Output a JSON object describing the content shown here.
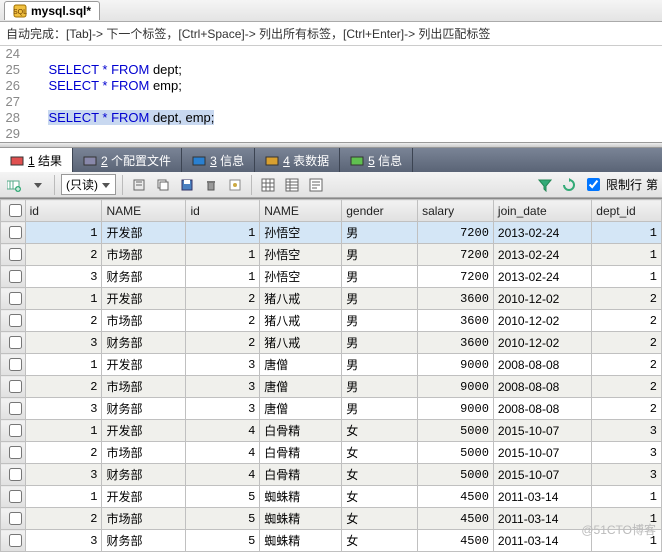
{
  "filetab": {
    "label": "mysql.sql*"
  },
  "tip": "自动完成：[Tab]-> 下一个标签，[Ctrl+Space]-> 列出所有标签，[Ctrl+Enter]-> 列出匹配标签",
  "editor": {
    "lines": [
      {
        "n": "24",
        "pre": "",
        "kw": "",
        "post": ""
      },
      {
        "n": "25",
        "pre": "    ",
        "kw": "SELECT * FROM",
        "post": " dept;"
      },
      {
        "n": "26",
        "pre": "    ",
        "kw": "SELECT * FROM",
        "post": " emp;"
      },
      {
        "n": "27",
        "pre": "",
        "kw": "",
        "post": ""
      },
      {
        "n": "28",
        "pre": "    ",
        "kw": "SELECT * FROM",
        "post": " dept, emp;",
        "sel": true
      },
      {
        "n": "29",
        "pre": "",
        "kw": "",
        "post": ""
      }
    ]
  },
  "result_tabs": [
    {
      "key": "1",
      "label": "结果",
      "active": true
    },
    {
      "key": "2",
      "label": "个配置文件"
    },
    {
      "key": "3",
      "label": "信息"
    },
    {
      "key": "4",
      "label": "表数据"
    },
    {
      "key": "5",
      "label": "信息"
    }
  ],
  "toolbar": {
    "readonly_label": "(只读)",
    "limit_label": "限制行",
    "limit_more": "第"
  },
  "grid": {
    "columns": [
      "id",
      "NAME",
      "id",
      "NAME",
      "gender",
      "salary",
      "join_date",
      "dept_id"
    ],
    "rows": [
      {
        "id1": 1,
        "dept": "开发部",
        "id2": 1,
        "emp": "孙悟空",
        "gender": "男",
        "salary": 7200,
        "join": "2013-02-24",
        "deptid": 1,
        "selected": true
      },
      {
        "id1": 2,
        "dept": "市场部",
        "id2": 1,
        "emp": "孙悟空",
        "gender": "男",
        "salary": 7200,
        "join": "2013-02-24",
        "deptid": 1
      },
      {
        "id1": 3,
        "dept": "财务部",
        "id2": 1,
        "emp": "孙悟空",
        "gender": "男",
        "salary": 7200,
        "join": "2013-02-24",
        "deptid": 1
      },
      {
        "id1": 1,
        "dept": "开发部",
        "id2": 2,
        "emp": "猪八戒",
        "gender": "男",
        "salary": 3600,
        "join": "2010-12-02",
        "deptid": 2
      },
      {
        "id1": 2,
        "dept": "市场部",
        "id2": 2,
        "emp": "猪八戒",
        "gender": "男",
        "salary": 3600,
        "join": "2010-12-02",
        "deptid": 2
      },
      {
        "id1": 3,
        "dept": "财务部",
        "id2": 2,
        "emp": "猪八戒",
        "gender": "男",
        "salary": 3600,
        "join": "2010-12-02",
        "deptid": 2
      },
      {
        "id1": 1,
        "dept": "开发部",
        "id2": 3,
        "emp": "唐僧",
        "gender": "男",
        "salary": 9000,
        "join": "2008-08-08",
        "deptid": 2
      },
      {
        "id1": 2,
        "dept": "市场部",
        "id2": 3,
        "emp": "唐僧",
        "gender": "男",
        "salary": 9000,
        "join": "2008-08-08",
        "deptid": 2
      },
      {
        "id1": 3,
        "dept": "财务部",
        "id2": 3,
        "emp": "唐僧",
        "gender": "男",
        "salary": 9000,
        "join": "2008-08-08",
        "deptid": 2
      },
      {
        "id1": 1,
        "dept": "开发部",
        "id2": 4,
        "emp": "白骨精",
        "gender": "女",
        "salary": 5000,
        "join": "2015-10-07",
        "deptid": 3
      },
      {
        "id1": 2,
        "dept": "市场部",
        "id2": 4,
        "emp": "白骨精",
        "gender": "女",
        "salary": 5000,
        "join": "2015-10-07",
        "deptid": 3
      },
      {
        "id1": 3,
        "dept": "财务部",
        "id2": 4,
        "emp": "白骨精",
        "gender": "女",
        "salary": 5000,
        "join": "2015-10-07",
        "deptid": 3
      },
      {
        "id1": 1,
        "dept": "开发部",
        "id2": 5,
        "emp": "蜘蛛精",
        "gender": "女",
        "salary": 4500,
        "join": "2011-03-14",
        "deptid": 1
      },
      {
        "id1": 2,
        "dept": "市场部",
        "id2": 5,
        "emp": "蜘蛛精",
        "gender": "女",
        "salary": 4500,
        "join": "2011-03-14",
        "deptid": 1
      },
      {
        "id1": 3,
        "dept": "财务部",
        "id2": 5,
        "emp": "蜘蛛精",
        "gender": "女",
        "salary": 4500,
        "join": "2011-03-14",
        "deptid": 1
      }
    ]
  },
  "watermark": "@51CTO博客"
}
